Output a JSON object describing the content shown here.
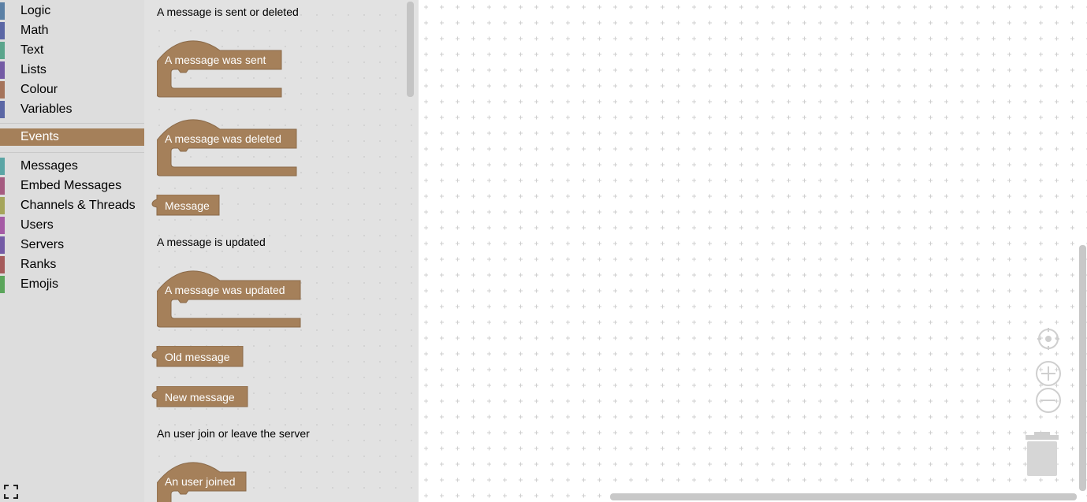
{
  "toolbox": {
    "categories": [
      {
        "label": "Logic",
        "color": "#5b80a5"
      },
      {
        "label": "Math",
        "color": "#5b67a5"
      },
      {
        "label": "Text",
        "color": "#5ba58c"
      },
      {
        "label": "Lists",
        "color": "#745ba5"
      },
      {
        "label": "Colour",
        "color": "#a5745b"
      },
      {
        "label": "Variables",
        "color": "#5b67a5"
      }
    ],
    "selected": {
      "label": "Events",
      "color": "#a5805a"
    },
    "extra_categories": [
      {
        "label": "Messages",
        "color": "#5ba5a5"
      },
      {
        "label": "Embed Messages",
        "color": "#a55b80"
      },
      {
        "label": "Channels & Threads",
        "color": "#a5a55b"
      },
      {
        "label": "Users",
        "color": "#a55ba5"
      },
      {
        "label": "Servers",
        "color": "#745ba5"
      },
      {
        "label": "Ranks",
        "color": "#a55b5b"
      },
      {
        "label": "Emojis",
        "color": "#5ba55b"
      }
    ]
  },
  "flyout": {
    "section1_label": "A message is sent or deleted",
    "block_sent": "A message was sent",
    "block_deleted": "A message was deleted",
    "block_message": "Message",
    "section2_label": "A message is updated",
    "block_updated": "A message was updated",
    "block_old_message": "Old message",
    "block_new_message": "New message",
    "section3_label": "An user join or leave the server",
    "block_user_joined": "An user joined",
    "block_color": "#a5805a"
  }
}
